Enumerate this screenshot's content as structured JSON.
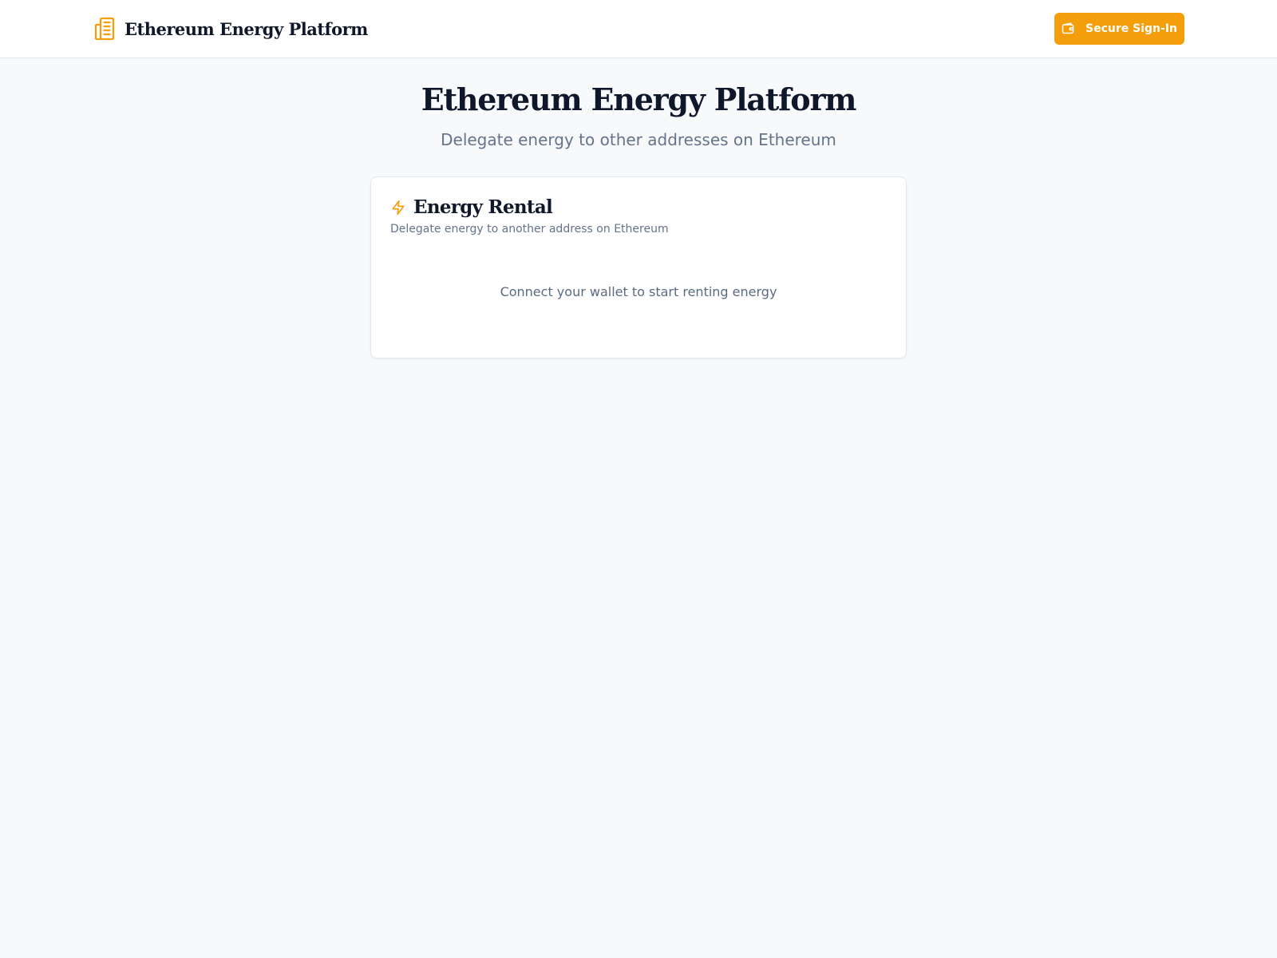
{
  "header": {
    "brand_title": "Ethereum Energy Platform",
    "brand_icon": "building-icon",
    "signin_label": "Secure Sign-In",
    "signin_icon": "wallet-icon"
  },
  "hero": {
    "title": "Ethereum Energy Platform",
    "subtitle": "Delegate energy to other addresses on Ethereum"
  },
  "rental_card": {
    "icon": "bolt-icon",
    "title": "Energy Rental",
    "description": "Delegate energy to another address on Ethereum",
    "empty_message": "Connect your wallet to start renting energy"
  },
  "colors": {
    "accent": "#f59e0b",
    "page_background": "#f8f9fb",
    "heading": "#0f172a",
    "muted_text": "#64748b"
  }
}
